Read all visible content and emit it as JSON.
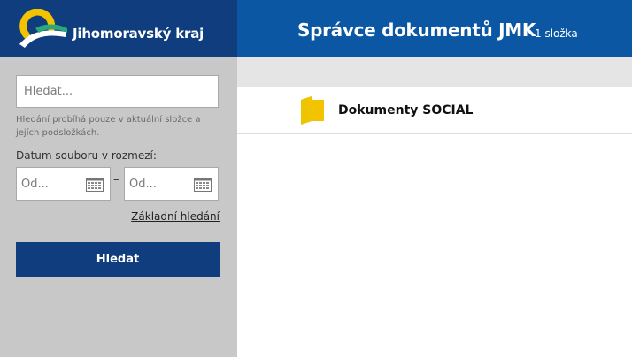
{
  "brand": {
    "name": "Jihomoravský kraj",
    "logo_icon": "jmk-logo-icon",
    "colors": {
      "navy": "#0f3d7d",
      "blue": "#0b57a4",
      "yellow": "#f3c300",
      "green": "#2aa77b"
    }
  },
  "header": {
    "title": "Správce dokumentů JMK",
    "count": "1 složka"
  },
  "sidebar": {
    "search_placeholder": "Hledat...",
    "hint": "Hledání probíhá pouze v aktuální složce a jejích podsložkách.",
    "date_label": "Datum souboru v rozmezí:",
    "date_from_placeholder": "Od...",
    "date_to_placeholder": "Od...",
    "date_separator": "–",
    "basic_search_link": "Základní hledání",
    "search_button": "Hledat"
  },
  "content": {
    "items": [
      {
        "name": "Dokumenty SOCIAL",
        "icon": "folder-icon"
      }
    ]
  }
}
